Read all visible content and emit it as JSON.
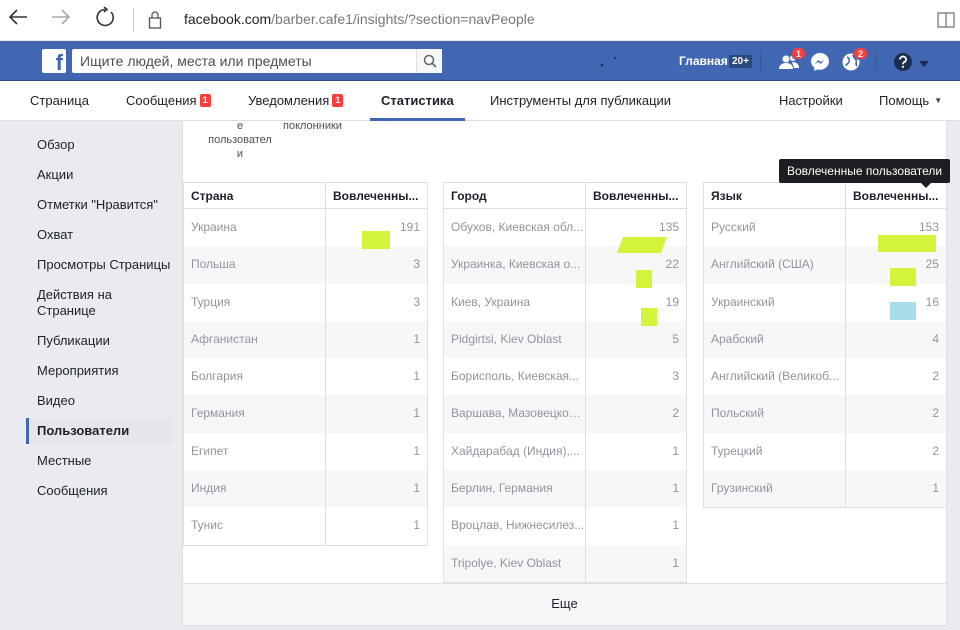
{
  "browser": {
    "url_host": "facebook.com",
    "url_rest": "/barber.cafe1/insights/?section=navPeople"
  },
  "topbar": {
    "logo": "f",
    "search_placeholder": "Ищите людей, места или предметы",
    "home_label": "Главная",
    "home_badge": "20+",
    "friends_badge": "1",
    "globe_badge": "2"
  },
  "tabs": [
    {
      "label": "Страница"
    },
    {
      "label": "Сообщения",
      "badge": "1"
    },
    {
      "label": "Уведомления",
      "badge": "1"
    },
    {
      "label": "Статистика",
      "active": true
    },
    {
      "label": "Инструменты для публикации"
    },
    {
      "label": "Настройки"
    },
    {
      "label": "Помощь"
    }
  ],
  "sidebar": {
    "items": [
      {
        "label": "Обзор"
      },
      {
        "label": "Акции"
      },
      {
        "label": "Отметки \"Нравится\""
      },
      {
        "label": "Охват"
      },
      {
        "label": "Просмотры Страницы"
      },
      {
        "label": "Действия на Странице"
      },
      {
        "label": "Публикации"
      },
      {
        "label": "Мероприятия"
      },
      {
        "label": "Видео"
      },
      {
        "label": "Пользователи",
        "active": true
      },
      {
        "label": "Местные"
      },
      {
        "label": "Сообщения"
      }
    ]
  },
  "cutoff": {
    "left": "е\nпользовател\nи",
    "right": "поклонники"
  },
  "tooltip": "Вовлеченные пользователи",
  "country_table": {
    "col1": "Страна",
    "col2": "Вовлеченны...",
    "rows": [
      {
        "name": "Украина",
        "value": "191"
      },
      {
        "name": "Польша",
        "value": "3"
      },
      {
        "name": "Турция",
        "value": "3"
      },
      {
        "name": "Афганистан",
        "value": "1"
      },
      {
        "name": "Болгария",
        "value": "1"
      },
      {
        "name": "Германия",
        "value": "1"
      },
      {
        "name": "Египет",
        "value": "1"
      },
      {
        "name": "Индия",
        "value": "1"
      },
      {
        "name": "Тунис",
        "value": "1"
      }
    ]
  },
  "city_table": {
    "col1": "Город",
    "col2": "Вовлеченны...",
    "rows": [
      {
        "name": "Обухов, Киевская обл...",
        "value": "135"
      },
      {
        "name": "Украинка, Киевская о...",
        "value": "22"
      },
      {
        "name": "Киев, Украина",
        "value": "19"
      },
      {
        "name": "Pidgirtsi, Kiev Oblast",
        "value": "5"
      },
      {
        "name": "Борисполь, Киевская...",
        "value": "3"
      },
      {
        "name": "Варшава, Мазовецкое...",
        "value": "2"
      },
      {
        "name": "Хайдарабад (Индия),...",
        "value": "1"
      },
      {
        "name": "Берлин, Германия",
        "value": "1"
      },
      {
        "name": "Вроцлав, Нижнесилез...",
        "value": "1"
      },
      {
        "name": "Tripolye, Kiev Oblast",
        "value": "1"
      }
    ]
  },
  "language_table": {
    "col1": "Язык",
    "col2": "Вовлеченны...",
    "rows": [
      {
        "name": "Русский",
        "value": "153"
      },
      {
        "name": "Английский (США)",
        "value": "25"
      },
      {
        "name": "Украинский",
        "value": "16"
      },
      {
        "name": "Арабский",
        "value": "4"
      },
      {
        "name": "Английский (Великоб...",
        "value": "2"
      },
      {
        "name": "Польский",
        "value": "2"
      },
      {
        "name": "Турецкий",
        "value": "2"
      },
      {
        "name": "Грузинский",
        "value": "1"
      }
    ]
  },
  "more_label": "Еще",
  "colors": {
    "fb_blue": "#4267b2",
    "highlight_green": "#d2f53c",
    "highlight_blue": "#a8dcea"
  }
}
